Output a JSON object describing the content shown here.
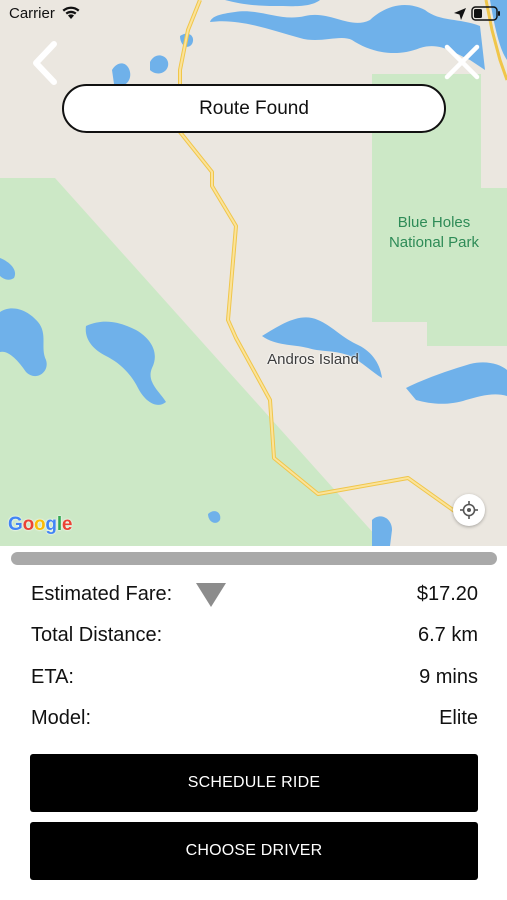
{
  "status_bar": {
    "carrier": "Carrier",
    "wifi_icon": "wifi-icon",
    "location_icon": "location-arrow-icon",
    "battery_icon": "battery-icon"
  },
  "header": {
    "back_icon": "chevron-left-icon",
    "close_icon": "close-icon",
    "banner_text": "Route Found"
  },
  "map": {
    "labels": {
      "park": "Blue Holes National Park",
      "island": "Andros Island"
    },
    "attribution": {
      "g1": "G",
      "o1": "o",
      "o2": "o",
      "g2": "g",
      "l": "l",
      "e": "e"
    },
    "locate_icon": "crosshair-icon",
    "colors": {
      "land": "#ebe7e0",
      "park": "#cce8c6",
      "water": "#6fb1ea",
      "road": "#f5d676"
    }
  },
  "trip": {
    "fare_label": "Estimated Fare:",
    "fare_value": "$17.20",
    "fare_toggle_icon": "triangle-down-icon",
    "distance_label": "Total Distance:",
    "distance_value": "6.7 km",
    "eta_label": "ETA:",
    "eta_value": "9 mins",
    "model_label": "Model:",
    "model_value": "Elite"
  },
  "actions": {
    "schedule_label": "SCHEDULE RIDE",
    "choose_driver_label": "CHOOSE DRIVER"
  }
}
